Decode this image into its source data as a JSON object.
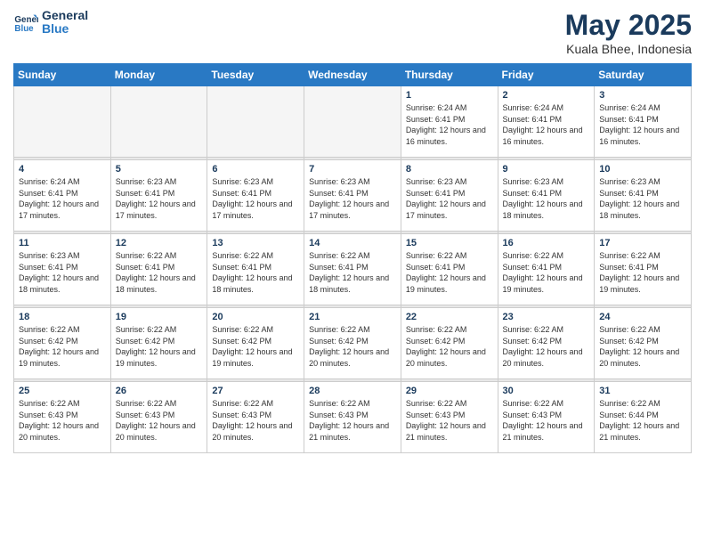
{
  "header": {
    "logo_line1": "General",
    "logo_line2": "Blue",
    "title": "May 2025",
    "subtitle": "Kuala Bhee, Indonesia"
  },
  "days_of_week": [
    "Sunday",
    "Monday",
    "Tuesday",
    "Wednesday",
    "Thursday",
    "Friday",
    "Saturday"
  ],
  "weeks": [
    [
      {
        "num": "",
        "empty": true
      },
      {
        "num": "",
        "empty": true
      },
      {
        "num": "",
        "empty": true
      },
      {
        "num": "",
        "empty": true
      },
      {
        "num": "1",
        "sunrise": "6:24 AM",
        "sunset": "6:41 PM",
        "daylight": "12 hours and 16 minutes."
      },
      {
        "num": "2",
        "sunrise": "6:24 AM",
        "sunset": "6:41 PM",
        "daylight": "12 hours and 16 minutes."
      },
      {
        "num": "3",
        "sunrise": "6:24 AM",
        "sunset": "6:41 PM",
        "daylight": "12 hours and 16 minutes."
      }
    ],
    [
      {
        "num": "4",
        "sunrise": "6:24 AM",
        "sunset": "6:41 PM",
        "daylight": "12 hours and 17 minutes."
      },
      {
        "num": "5",
        "sunrise": "6:23 AM",
        "sunset": "6:41 PM",
        "daylight": "12 hours and 17 minutes."
      },
      {
        "num": "6",
        "sunrise": "6:23 AM",
        "sunset": "6:41 PM",
        "daylight": "12 hours and 17 minutes."
      },
      {
        "num": "7",
        "sunrise": "6:23 AM",
        "sunset": "6:41 PM",
        "daylight": "12 hours and 17 minutes."
      },
      {
        "num": "8",
        "sunrise": "6:23 AM",
        "sunset": "6:41 PM",
        "daylight": "12 hours and 17 minutes."
      },
      {
        "num": "9",
        "sunrise": "6:23 AM",
        "sunset": "6:41 PM",
        "daylight": "12 hours and 18 minutes."
      },
      {
        "num": "10",
        "sunrise": "6:23 AM",
        "sunset": "6:41 PM",
        "daylight": "12 hours and 18 minutes."
      }
    ],
    [
      {
        "num": "11",
        "sunrise": "6:23 AM",
        "sunset": "6:41 PM",
        "daylight": "12 hours and 18 minutes."
      },
      {
        "num": "12",
        "sunrise": "6:22 AM",
        "sunset": "6:41 PM",
        "daylight": "12 hours and 18 minutes."
      },
      {
        "num": "13",
        "sunrise": "6:22 AM",
        "sunset": "6:41 PM",
        "daylight": "12 hours and 18 minutes."
      },
      {
        "num": "14",
        "sunrise": "6:22 AM",
        "sunset": "6:41 PM",
        "daylight": "12 hours and 18 minutes."
      },
      {
        "num": "15",
        "sunrise": "6:22 AM",
        "sunset": "6:41 PM",
        "daylight": "12 hours and 19 minutes."
      },
      {
        "num": "16",
        "sunrise": "6:22 AM",
        "sunset": "6:41 PM",
        "daylight": "12 hours and 19 minutes."
      },
      {
        "num": "17",
        "sunrise": "6:22 AM",
        "sunset": "6:41 PM",
        "daylight": "12 hours and 19 minutes."
      }
    ],
    [
      {
        "num": "18",
        "sunrise": "6:22 AM",
        "sunset": "6:42 PM",
        "daylight": "12 hours and 19 minutes."
      },
      {
        "num": "19",
        "sunrise": "6:22 AM",
        "sunset": "6:42 PM",
        "daylight": "12 hours and 19 minutes."
      },
      {
        "num": "20",
        "sunrise": "6:22 AM",
        "sunset": "6:42 PM",
        "daylight": "12 hours and 19 minutes."
      },
      {
        "num": "21",
        "sunrise": "6:22 AM",
        "sunset": "6:42 PM",
        "daylight": "12 hours and 20 minutes."
      },
      {
        "num": "22",
        "sunrise": "6:22 AM",
        "sunset": "6:42 PM",
        "daylight": "12 hours and 20 minutes."
      },
      {
        "num": "23",
        "sunrise": "6:22 AM",
        "sunset": "6:42 PM",
        "daylight": "12 hours and 20 minutes."
      },
      {
        "num": "24",
        "sunrise": "6:22 AM",
        "sunset": "6:42 PM",
        "daylight": "12 hours and 20 minutes."
      }
    ],
    [
      {
        "num": "25",
        "sunrise": "6:22 AM",
        "sunset": "6:43 PM",
        "daylight": "12 hours and 20 minutes."
      },
      {
        "num": "26",
        "sunrise": "6:22 AM",
        "sunset": "6:43 PM",
        "daylight": "12 hours and 20 minutes."
      },
      {
        "num": "27",
        "sunrise": "6:22 AM",
        "sunset": "6:43 PM",
        "daylight": "12 hours and 20 minutes."
      },
      {
        "num": "28",
        "sunrise": "6:22 AM",
        "sunset": "6:43 PM",
        "daylight": "12 hours and 21 minutes."
      },
      {
        "num": "29",
        "sunrise": "6:22 AM",
        "sunset": "6:43 PM",
        "daylight": "12 hours and 21 minutes."
      },
      {
        "num": "30",
        "sunrise": "6:22 AM",
        "sunset": "6:43 PM",
        "daylight": "12 hours and 21 minutes."
      },
      {
        "num": "31",
        "sunrise": "6:22 AM",
        "sunset": "6:44 PM",
        "daylight": "12 hours and 21 minutes."
      }
    ]
  ],
  "labels": {
    "sunrise": "Sunrise:",
    "sunset": "Sunset:",
    "daylight": "Daylight:"
  },
  "colors": {
    "header_bg": "#2979c4",
    "title_color": "#1a3a5c"
  }
}
